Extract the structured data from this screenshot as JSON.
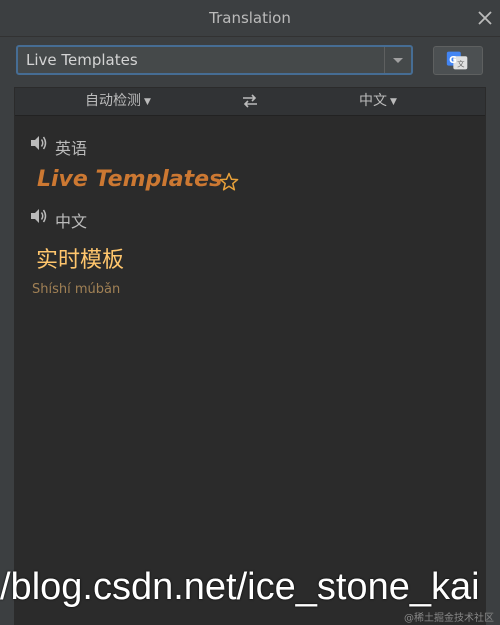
{
  "window": {
    "title": "Translation"
  },
  "input": {
    "value": "Live Templates"
  },
  "language_bar": {
    "source_lang": "自动检测",
    "target_lang": "中文"
  },
  "result": {
    "source_label": "英语",
    "source_text": "Live Templates",
    "target_label": "中文",
    "translation": "实时模板",
    "transliteration": "Shíshí múbǎn"
  },
  "watermark": {
    "url_text": "/blog.csdn.net/ice_stone_kai",
    "small_text": "@稀土掘金技术社区"
  },
  "colors": {
    "accent_orange": "#cc7832",
    "translation_gold": "#ffc66d",
    "focus_border": "#466d94"
  },
  "icons": {
    "close": "close-icon",
    "dropdown": "chevron-down-icon",
    "translate_button": "google-translate-icon",
    "swap": "swap-icon",
    "speaker": "speaker-icon",
    "favorite": "star-icon"
  }
}
